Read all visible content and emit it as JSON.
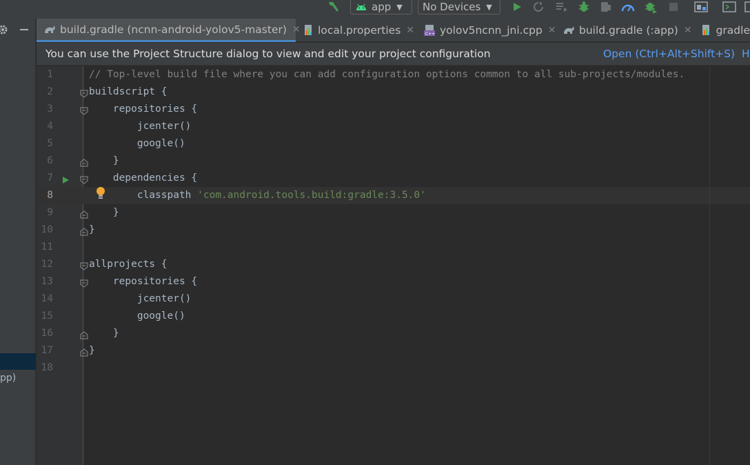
{
  "toolbar": {
    "run_config": "app",
    "device": "No Devices",
    "icons": [
      "hammer-icon",
      "android-icon",
      "run-icon",
      "apply-changes-icon",
      "apply-code-changes-icon",
      "debug-icon",
      "profile-icon",
      "attach-debugger-icon",
      "stop-icon",
      "sdk-manager-icon",
      "terminal-icon"
    ]
  },
  "left_panel": {
    "partial_text": "pp)"
  },
  "tabs": [
    {
      "label": "build.gradle (ncnn-android-yolov5-master)",
      "icon": "gradle-icon",
      "active": true
    },
    {
      "label": "local.properties",
      "icon": "properties-icon",
      "active": false
    },
    {
      "label": "yolov5ncnn_jni.cpp",
      "icon": "cpp-file-icon",
      "active": false
    },
    {
      "label": "build.gradle (:app)",
      "icon": "gradle-icon",
      "active": false
    },
    {
      "label": "gradle",
      "icon": "properties-icon",
      "active": false
    }
  ],
  "banner": {
    "message": "You can use the Project Structure dialog to view and edit your project configuration",
    "open_link": "Open (Ctrl+Alt+Shift+S)",
    "hide_link": "H"
  },
  "editor": {
    "current_line": 8,
    "lines": [
      {
        "n": "1",
        "text": "// Top-level build file where you can add configuration options common to all sub-projects/modules.",
        "kind": "comment"
      },
      {
        "n": "2",
        "text": "buildscript {"
      },
      {
        "n": "3",
        "text": "    repositories {"
      },
      {
        "n": "4",
        "text": "        jcenter()"
      },
      {
        "n": "5",
        "text": "        google()"
      },
      {
        "n": "6",
        "text": "    }"
      },
      {
        "n": "7",
        "text": "    dependencies {"
      },
      {
        "n": "8",
        "text": "        classpath ",
        "string": "'com.android.tools.build:gradle:3.5.0'"
      },
      {
        "n": "9",
        "text": "    }"
      },
      {
        "n": "10",
        "text": "}"
      },
      {
        "n": "11",
        "text": ""
      },
      {
        "n": "12",
        "text": "allprojects {"
      },
      {
        "n": "13",
        "text": "    repositories {"
      },
      {
        "n": "14",
        "text": "        jcenter()"
      },
      {
        "n": "15",
        "text": "        google()"
      },
      {
        "n": "16",
        "text": "    }"
      },
      {
        "n": "17",
        "text": "}"
      },
      {
        "n": "18",
        "text": ""
      }
    ]
  },
  "colors": {
    "background": "#2b2b2b",
    "gutter": "#313335",
    "comment": "#808080",
    "string": "#6a8759",
    "link": "#589df6",
    "run_green": "#499c54",
    "tab_underline": "#4a88c7"
  }
}
